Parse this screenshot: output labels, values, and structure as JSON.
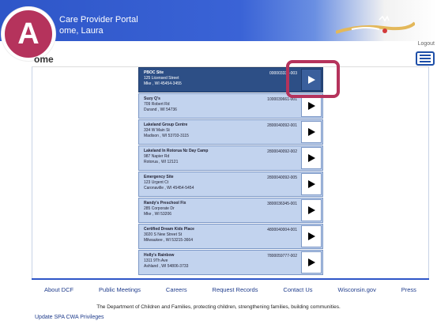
{
  "header": {
    "portal_title": "Care Provider Portal",
    "welcome": "ome, Laura"
  },
  "badge": {
    "letter": "A"
  },
  "logout_label": "Logout",
  "menu_icon": "hamburger-menu-icon",
  "page_title": "ome",
  "sites": [
    {
      "name": "PBOC Site",
      "street": "125 Licensed Street",
      "city": "Mke , WI 45454-3455",
      "id": "000003333-003",
      "selected": true
    },
    {
      "name": "Suzy Q's",
      "street": "709 Robert Rd",
      "city": "Durand , WI 54736",
      "id": "1000039661-001",
      "selected": false
    },
    {
      "name": "Lakeland Group Centre",
      "street": "334 W Main St",
      "city": "Madison , WI 53703-3115",
      "id": "2800040092-001",
      "selected": false
    },
    {
      "name": "Lakeland In Rotorua Nz Day Camp",
      "street": "987 Napier Rd",
      "city": "Rotorua , WI 12121",
      "id": "2800040092-002",
      "selected": false
    },
    {
      "name": "Emergency Site",
      "street": "123 Urgent Ct",
      "city": "Caronaville , WI 45454-5454",
      "id": "2800040092-005",
      "selected": false
    },
    {
      "name": "Randy's Preschool Fix",
      "street": "285 Corporate Dr",
      "city": "Mke , WI 53206",
      "id": "3800036345-001",
      "selected": false
    },
    {
      "name": "Certified Dream Kids Place",
      "street": "3020 S New Street St",
      "city": "Milwaukee , WI 53215-3664",
      "id": "4800040004-001",
      "selected": false
    },
    {
      "name": "Holly's Rainbow",
      "street": "1311 9Th Ave",
      "city": "Ashland , WI 54806-3733",
      "id": "7800059777-002",
      "selected": false
    }
  ],
  "footer": {
    "links": [
      "About DCF",
      "Public Meetings",
      "Careers",
      "Request Records",
      "Contact Us",
      "Wisconsin.gov",
      "Press"
    ],
    "tagline": "The Department of Children and Families, protecting children, strengthening families, building communities.",
    "update_privileges": "Update SPA CWA Privileges"
  },
  "colors": {
    "header_blue": "#2e56c8",
    "card_fill": "#c2d3ee",
    "card_selected": "#2d4f86",
    "highlight": "#b5335c"
  }
}
